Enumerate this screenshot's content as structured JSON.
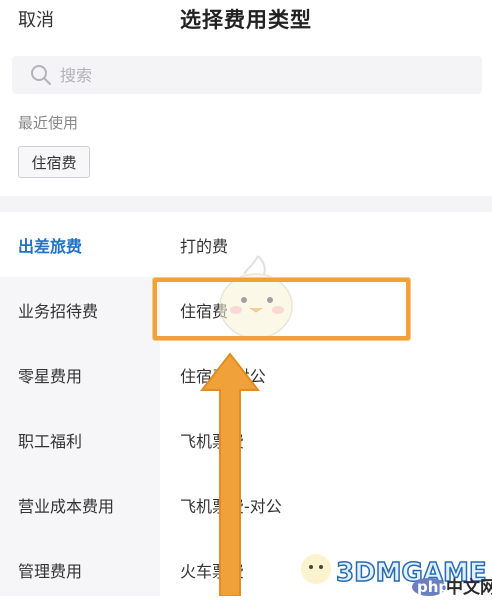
{
  "header": {
    "cancel_label": "取消",
    "title": "选择费用类型"
  },
  "search": {
    "placeholder": "搜索",
    "value": ""
  },
  "recent": {
    "label": "最近使用",
    "items": [
      "住宿费"
    ]
  },
  "categories": [
    {
      "label": "出差旅费",
      "active": true
    },
    {
      "label": "业务招待费",
      "active": false
    },
    {
      "label": "零星费用",
      "active": false
    },
    {
      "label": "职工福利",
      "active": false
    },
    {
      "label": "营业成本费用",
      "active": false
    },
    {
      "label": "管理费用",
      "active": false
    }
  ],
  "expense_items": [
    {
      "label": "打的费"
    },
    {
      "label": "住宿费"
    },
    {
      "label": "住宿费-对公"
    },
    {
      "label": "飞机票费"
    },
    {
      "label": "飞机票费-对公"
    },
    {
      "label": "火车票费"
    }
  ],
  "watermark": {
    "text": "3DMGAME",
    "badge": "php",
    "suffix": "中文网"
  },
  "colors": {
    "accent": "#1f73c7",
    "highlight": "#f0a13a",
    "panel_bg": "#f6f6f8"
  }
}
